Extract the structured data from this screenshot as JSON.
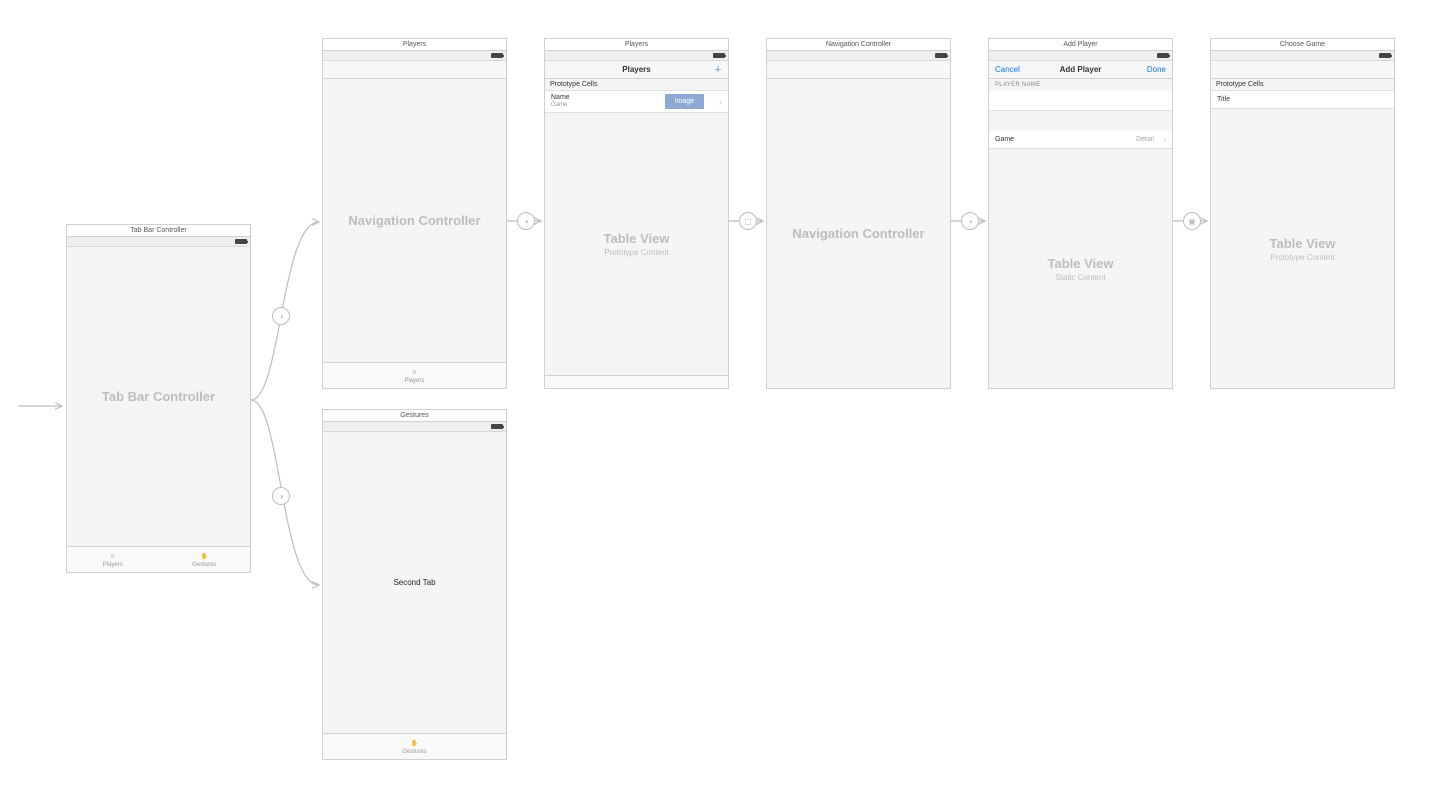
{
  "entry_arrow": true,
  "scenes": {
    "tabbar_controller": {
      "title": "Tab Bar Controller",
      "big": "Tab Bar Controller",
      "tabs": [
        {
          "label": "Players",
          "icon": "chess-icon"
        },
        {
          "label": "Gestures",
          "icon": "hand-icon"
        }
      ]
    },
    "players_nav": {
      "title": "Players",
      "big": "Navigation Controller",
      "tab_label": "Players",
      "tab_icon": "chess-icon"
    },
    "gestures": {
      "title": "Gestures",
      "mid": "Second Tab",
      "tab_label": "Gestures",
      "tab_icon": "hand-icon"
    },
    "players_table": {
      "title": "Players",
      "nav_title": "Players",
      "nav_right_icon": "plus-icon",
      "proto": "Prototype Cells",
      "cell_name": "Name",
      "cell_game": "Game",
      "image_chip": "Image",
      "big": "Table View",
      "sub": "Prototype Content"
    },
    "nav2": {
      "title": "Navigation Controller",
      "big": "Navigation Controller"
    },
    "add_player": {
      "title": "Add Player",
      "nav_left": "Cancel",
      "nav_title": "Add Player",
      "nav_right": "Done",
      "section": "PLAYER NAME",
      "row_game": "Game",
      "row_detail": "Detail",
      "big": "Table View",
      "sub": "Static Content"
    },
    "choose_game": {
      "title": "Choose Game",
      "proto": "Prototype Cells",
      "cell_title": "Title",
      "big": "Table View",
      "sub": "Prototype Content"
    }
  }
}
